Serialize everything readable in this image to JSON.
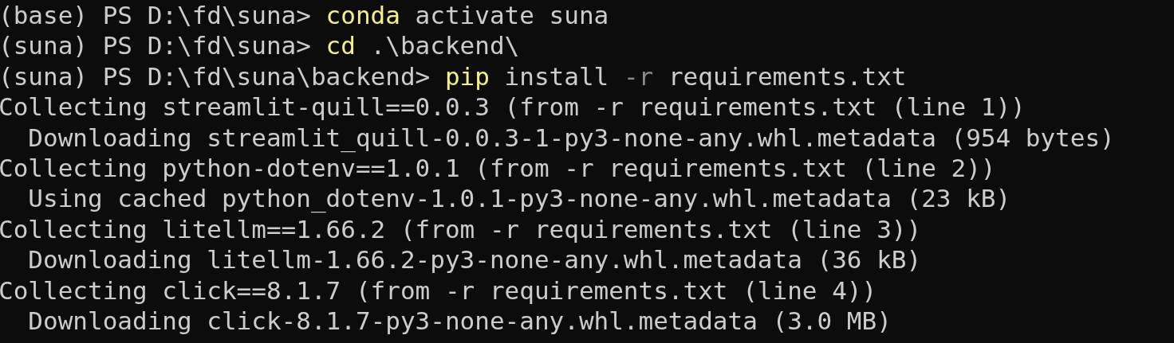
{
  "terminal": {
    "lines": [
      {
        "segments": [
          {
            "text": "(base) PS D:\\fd\\suna> ",
            "kind": "output"
          },
          {
            "text": "conda",
            "kind": "command"
          },
          {
            "text": " activate suna",
            "kind": "output"
          }
        ]
      },
      {
        "segments": [
          {
            "text": "(suna) PS D:\\fd\\suna> ",
            "kind": "output"
          },
          {
            "text": "cd",
            "kind": "command"
          },
          {
            "text": " .\\backend\\",
            "kind": "output"
          }
        ]
      },
      {
        "segments": [
          {
            "text": "(suna) PS D:\\fd\\suna\\backend> ",
            "kind": "output"
          },
          {
            "text": "pip",
            "kind": "command"
          },
          {
            "text": " install ",
            "kind": "output"
          },
          {
            "text": "-r",
            "kind": "flag"
          },
          {
            "text": " requirements.txt",
            "kind": "output"
          }
        ]
      },
      {
        "segments": [
          {
            "text": "Collecting streamlit-quill==0.0.3 (from -r requirements.txt (line 1))",
            "kind": "output"
          }
        ]
      },
      {
        "segments": [
          {
            "text": "  Downloading streamlit_quill-0.0.3-1-py3-none-any.whl.metadata (954 bytes)",
            "kind": "output"
          }
        ]
      },
      {
        "segments": [
          {
            "text": "Collecting python-dotenv==1.0.1 (from -r requirements.txt (line 2))",
            "kind": "output"
          }
        ]
      },
      {
        "segments": [
          {
            "text": "  Using cached python_dotenv-1.0.1-py3-none-any.whl.metadata (23 kB)",
            "kind": "output"
          }
        ]
      },
      {
        "segments": [
          {
            "text": "Collecting litellm==1.66.2 (from -r requirements.txt (line 3))",
            "kind": "output"
          }
        ]
      },
      {
        "segments": [
          {
            "text": "  Downloading litellm-1.66.2-py3-none-any.whl.metadata (36 kB)",
            "kind": "output"
          }
        ]
      },
      {
        "segments": [
          {
            "text": "Collecting click==8.1.7 (from -r requirements.txt (line 4))",
            "kind": "output"
          }
        ]
      },
      {
        "segments": [
          {
            "text": "  Downloading click-8.1.7-py3-none-any.whl.metadata (3.0 MB)",
            "kind": "output"
          }
        ]
      }
    ]
  }
}
